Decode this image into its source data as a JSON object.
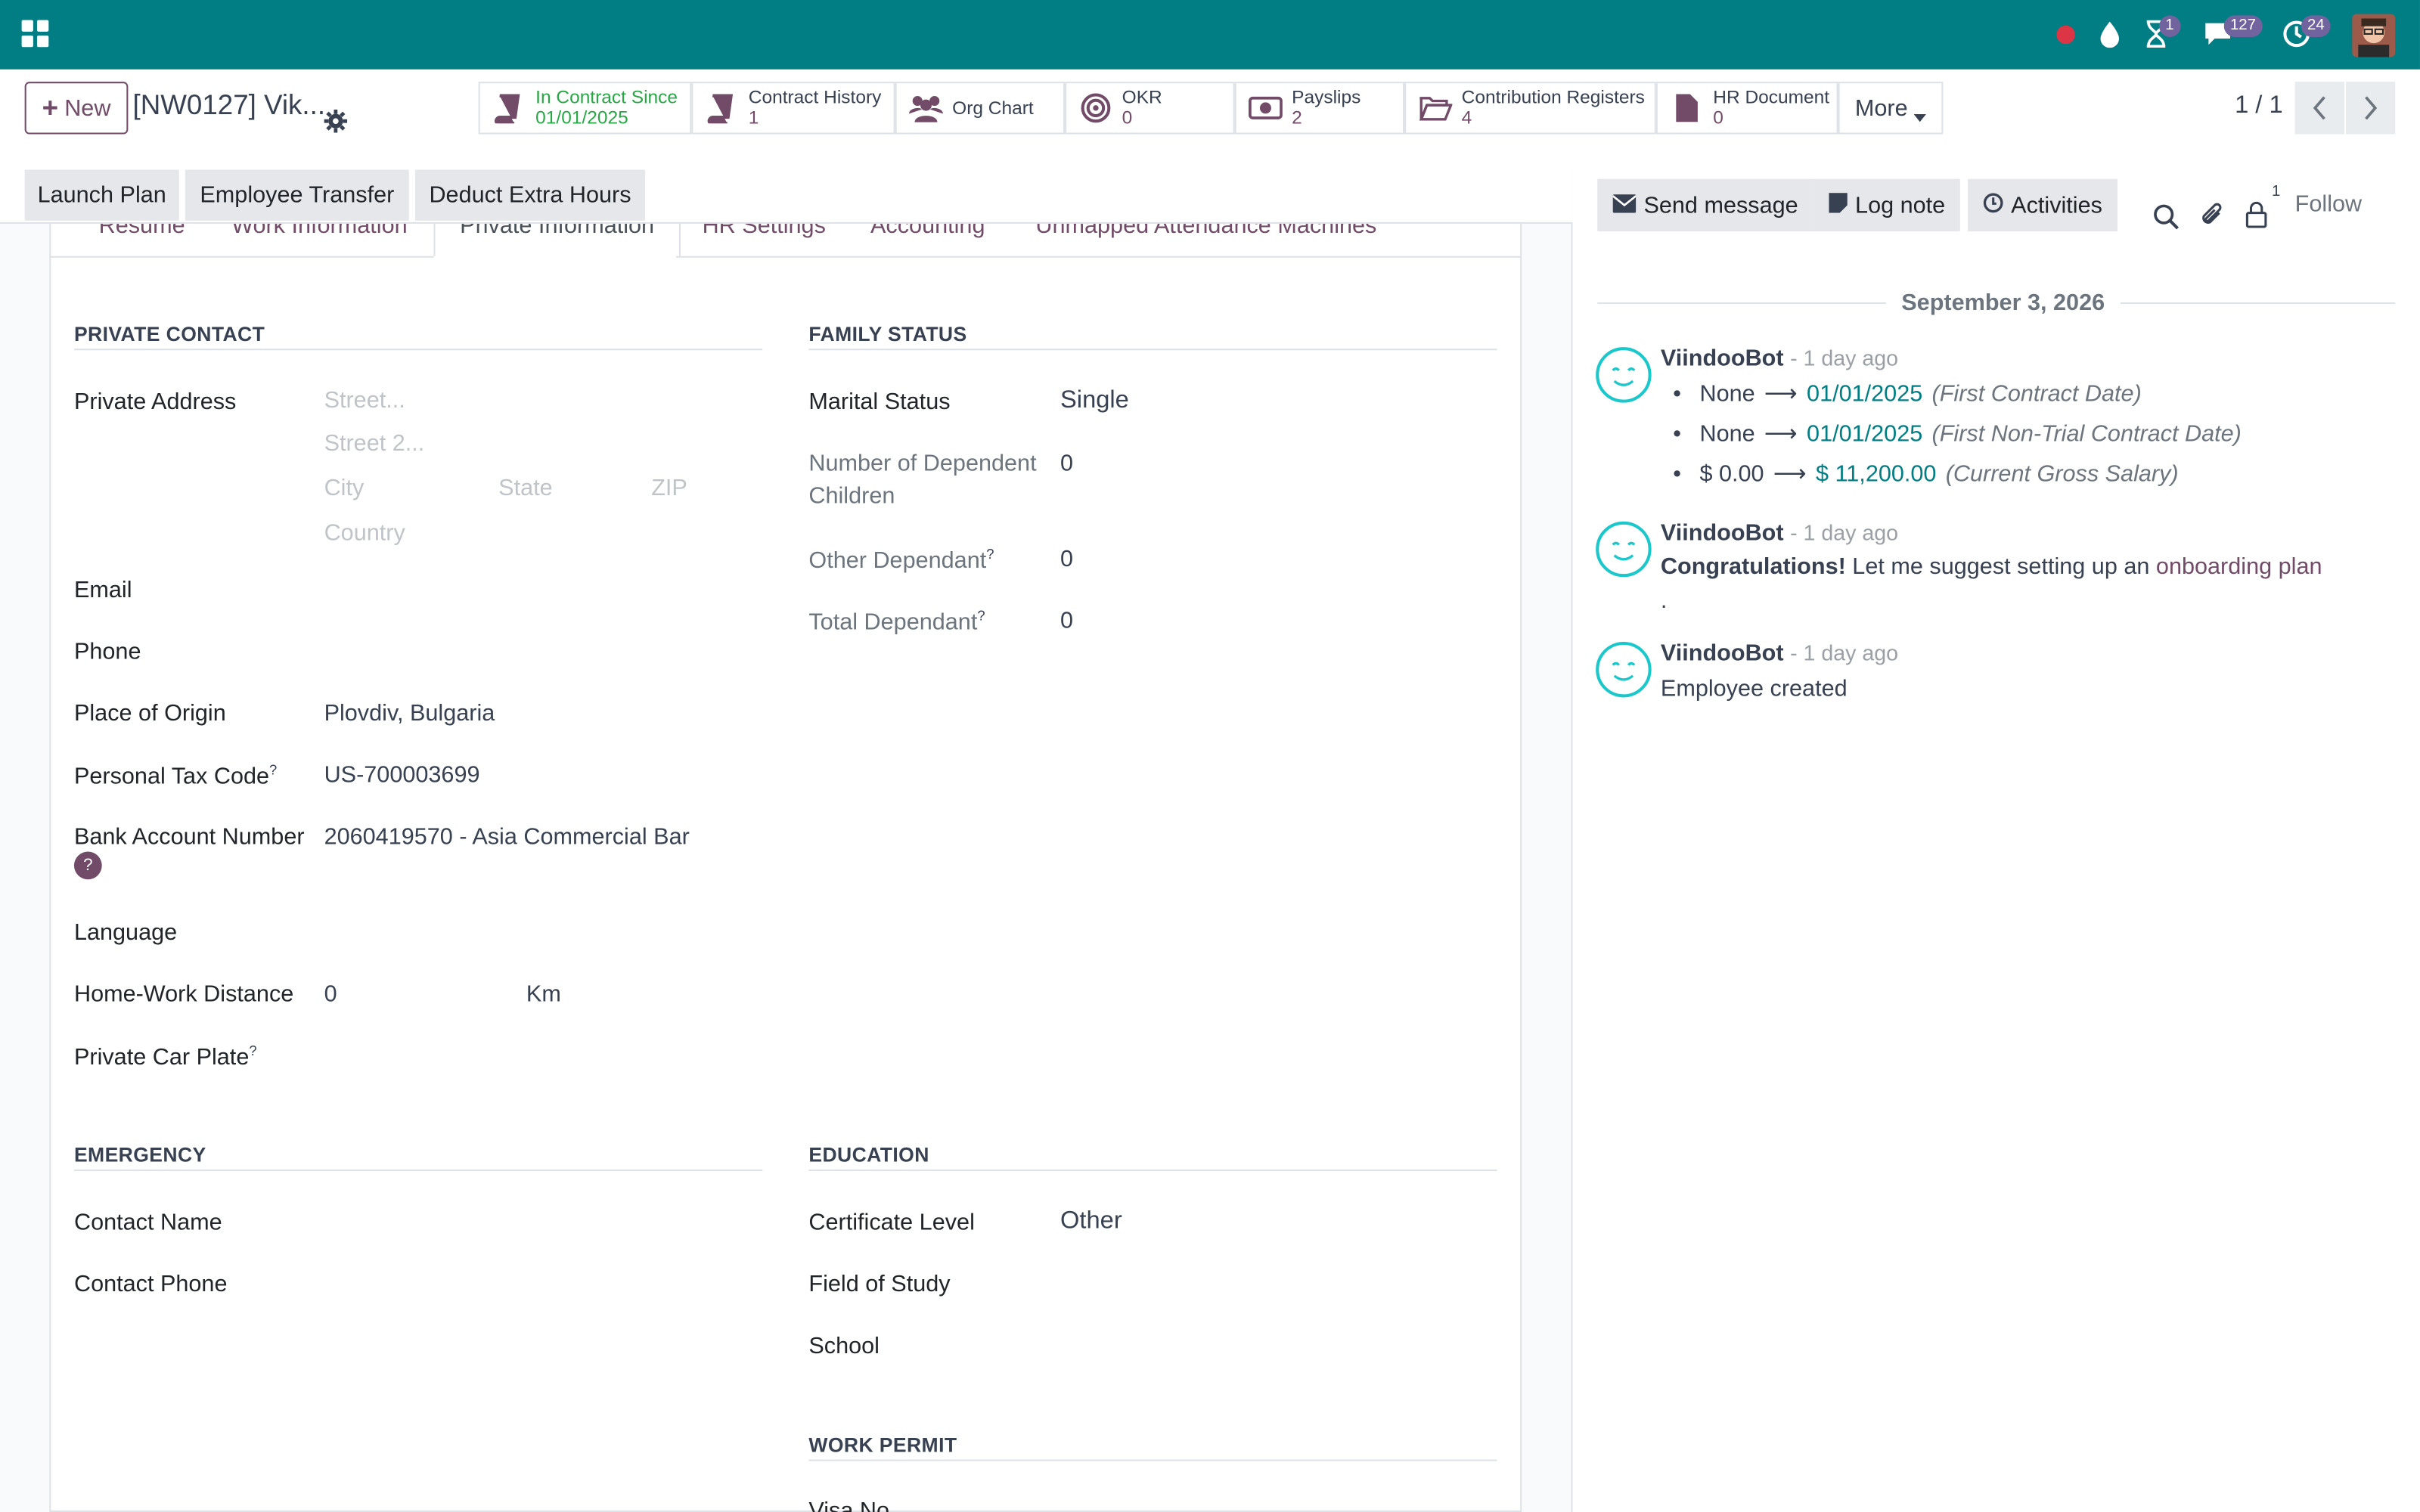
{
  "topbar": {
    "badges": {
      "activity": "1",
      "messages": "127",
      "clock": "24"
    }
  },
  "control": {
    "new_label": "New",
    "record_title": "[NW0127] Vik...",
    "pager": "1 / 1"
  },
  "smart_buttons": [
    {
      "t1": "In Contract Since",
      "t2": "01/01/2025"
    },
    {
      "t1": "Contract History",
      "t2": "1"
    },
    {
      "t1": "Org Chart",
      "t2": ""
    },
    {
      "t1": "OKR",
      "t2": "0"
    },
    {
      "t1": "Payslips",
      "t2": "2"
    },
    {
      "t1": "Contribution Registers",
      "t2": "4"
    },
    {
      "t1": "HR Document",
      "t2": "0"
    },
    {
      "t1": "More",
      "t2": ""
    }
  ],
  "header_buttons": [
    "Launch Plan",
    "Employee Transfer",
    "Deduct Extra Hours"
  ],
  "tabs": [
    "Resume",
    "Work Information",
    "Private Information",
    "HR Settings",
    "Accounting",
    "Unmapped Attendance Machines"
  ],
  "private_contact": {
    "title": "PRIVATE CONTACT",
    "address_label": "Private Address",
    "street_ph": "Street...",
    "street2_ph": "Street 2...",
    "city_ph": "City",
    "state_ph": "State",
    "zip_ph": "ZIP",
    "country_ph": "Country",
    "email_label": "Email",
    "phone_label": "Phone",
    "origin_label": "Place of Origin",
    "origin_value": "Plovdiv, Bulgaria",
    "tax_label": "Personal Tax Code",
    "tax_value": "US-700003699",
    "bank_label": "Bank Account Number",
    "bank_value": "2060419570 - Asia Commercial Bar",
    "lang_label": "Language",
    "dist_label": "Home-Work Distance",
    "dist_value": "0",
    "dist_unit": "Km",
    "car_label": "Private Car Plate"
  },
  "family": {
    "title": "FAMILY STATUS",
    "marital_label": "Marital Status",
    "marital_value": "Single",
    "children_label1": "Number of Dependent",
    "children_label2": "Children",
    "children_value": "0",
    "other_label": "Other Dependant",
    "other_value": "0",
    "total_label": "Total Dependant",
    "total_value": "0"
  },
  "emergency": {
    "title": "EMERGENCY",
    "name_label": "Contact Name",
    "phone_label": "Contact Phone"
  },
  "education": {
    "title": "EDUCATION",
    "cert_label": "Certificate Level",
    "cert_value": "Other",
    "field_label": "Field of Study",
    "school_label": "School"
  },
  "work_permit": {
    "title": "WORK PERMIT",
    "visa_label": "Visa No"
  },
  "chatter": {
    "send": "Send message",
    "log": "Log note",
    "activities": "Activities",
    "follow": "Follow",
    "followers": "1",
    "date": "September 3, 2026",
    "messages": [
      {
        "author": "ViindooBot",
        "time": "- 1 day ago",
        "changes": [
          {
            "old": "None",
            "new": "01/01/2025",
            "field": "(First Contract Date)"
          },
          {
            "old": "None",
            "new": "01/01/2025",
            "field": "(First Non-Trial Contract Date)"
          },
          {
            "old": "$ 0.00",
            "new": "$ 11,200.00",
            "field": "(Current Gross Salary)"
          }
        ]
      },
      {
        "author": "ViindooBot",
        "time": "- 1 day ago",
        "bold": "Congratulations!",
        "text": " Let me suggest setting up an ",
        "link": "onboarding plan",
        "tail": "."
      },
      {
        "author": "ViindooBot",
        "time": "- 1 day ago",
        "text": "Employee created"
      }
    ]
  }
}
